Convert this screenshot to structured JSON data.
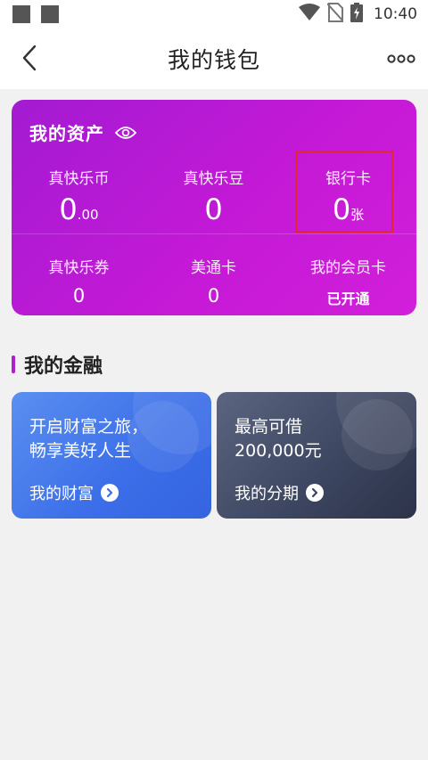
{
  "status_bar": {
    "time": "10:40",
    "icons": [
      "notification-square-icon",
      "notification-square-icon",
      "wifi-icon",
      "no-sim-icon",
      "battery-charging-icon"
    ]
  },
  "nav": {
    "title": "我的钱包",
    "back_icon": "chevron-left-icon",
    "more_icon": "more-dots-icon"
  },
  "assets": {
    "title": "我的资产",
    "eye_icon": "eye-icon",
    "items": [
      {
        "label": "真快乐币",
        "value_main": "0",
        "value_sub": ".00"
      },
      {
        "label": "真快乐豆",
        "value_main": "0"
      },
      {
        "label": "银行卡",
        "value_main": "0",
        "value_sub": "张"
      },
      {
        "label": "真快乐券",
        "value_main": "0"
      },
      {
        "label": "美通卡",
        "value_main": "0"
      },
      {
        "label": "我的会员卡",
        "value_text": "已开通"
      }
    ]
  },
  "finance": {
    "title": "我的金融",
    "cards": [
      {
        "line1": "开启财富之旅，",
        "line2": "畅享美好人生",
        "link": "我的财富",
        "color": "#3b6ee8"
      },
      {
        "line1": "最高可借",
        "line2": "200,000元",
        "link": "我的分期",
        "color": "#3c455f"
      }
    ]
  },
  "colors": {
    "asset_card": "#c419d6",
    "highlight_box": "#e3262f",
    "accent_bar": "#b01bd4"
  }
}
